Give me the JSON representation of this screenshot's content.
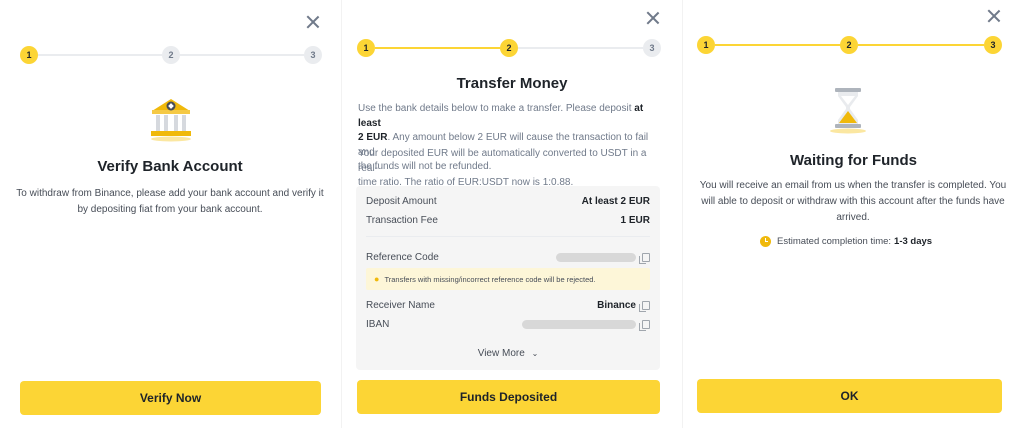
{
  "panel1": {
    "steps": [
      "1",
      "2",
      "3"
    ],
    "title": "Verify Bank Account",
    "description_line1": "To withdraw from Binance, please add your bank account and verify it",
    "description_line2": "by depositing fiat from your bank account.",
    "button_label": "Verify Now",
    "icon": "bank-icon"
  },
  "panel2": {
    "steps": [
      "1",
      "2",
      "3"
    ],
    "title": "Transfer Money",
    "intro_line1_pre": "Use the bank details below to make a transfer. Please deposit ",
    "intro_line1_bold": "at least",
    "intro_line2_bold": "2 EUR",
    "intro_line2_post": ". Any amount below 2 EUR will cause the transaction to fail and",
    "intro_line3": "the funds will not be refunded.",
    "conversion_line1": "Your deposited EUR will be automatically converted to USDT in a real-",
    "conversion_line2": "time ratio. The ratio of EUR:USDT now is 1:0.88.",
    "details": {
      "deposit_amount_label": "Deposit Amount",
      "deposit_amount_value": "At least 2 EUR",
      "transaction_fee_label": "Transaction Fee",
      "transaction_fee_value": "1 EUR",
      "reference_code_label": "Reference Code",
      "notice": "Transfers with missing/incorrect reference code will be rejected.",
      "receiver_name_label": "Receiver Name",
      "receiver_name_value": "Binance",
      "iban_label": "IBAN"
    },
    "view_more_label": "View More",
    "button_label": "Funds Deposited"
  },
  "panel3": {
    "steps": [
      "1",
      "2",
      "3"
    ],
    "title": "Waiting for Funds",
    "description_line1": "You will receive an email from us when the transfer is completed. You",
    "description_line2": "will able to deposit or withdraw with this account after the funds have",
    "description_line3": "arrived.",
    "eta_label": "Estimated completion time:",
    "eta_value": "1-3 days",
    "button_label": "OK",
    "icon": "hourglass-icon"
  },
  "colors": {
    "accent": "#fcd535",
    "inactive_step": "#eaecef",
    "text_primary": "#1e2329",
    "text_secondary": "#707a8a"
  }
}
